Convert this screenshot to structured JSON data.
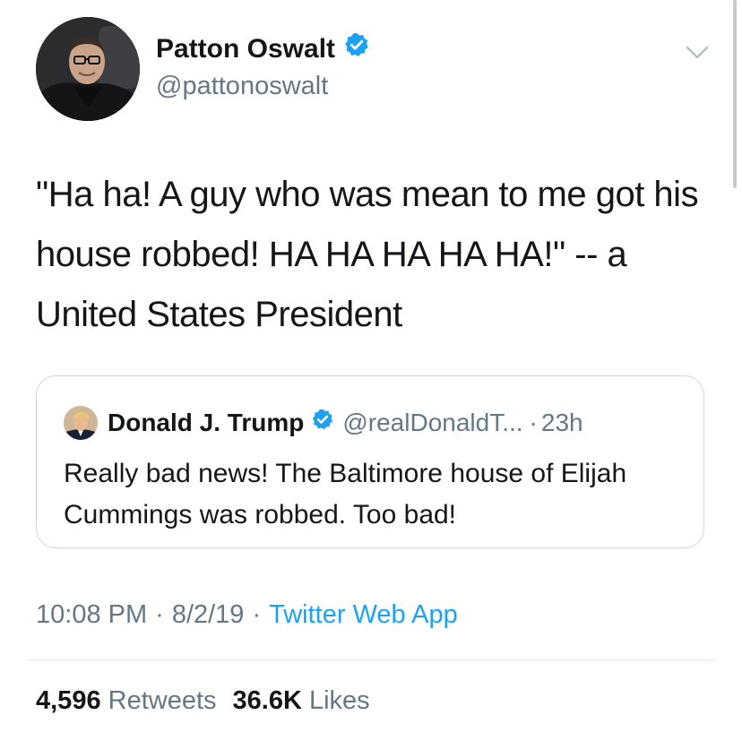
{
  "author": {
    "name": "Patton Oswalt",
    "handle": "@pattonoswalt",
    "verified_icon": "verified-badge-icon"
  },
  "tweet": {
    "text": "\"Ha ha! A guy who was mean to me got his house robbed! HA HA HA HA HA!\" -- a United States President"
  },
  "quoted_tweet": {
    "name": "Donald J. Trump",
    "handle": "@realDonaldT...",
    "dot": "·",
    "time": "23h",
    "text": "Really bad news! The Baltimore house of Elijah Cummings was robbed. Too bad!"
  },
  "meta": {
    "time": "10:08 PM",
    "sep1": "·",
    "date": "8/2/19",
    "sep2": "·",
    "source": "Twitter Web App"
  },
  "stats": {
    "retweets_count": "4,596",
    "retweets_label": "Retweets",
    "likes_count": "36.6K",
    "likes_label": "Likes"
  },
  "colors": {
    "accent": "#1da1f2",
    "text": "#14171a",
    "secondary_text": "#657786",
    "border": "#ccd6dd"
  }
}
